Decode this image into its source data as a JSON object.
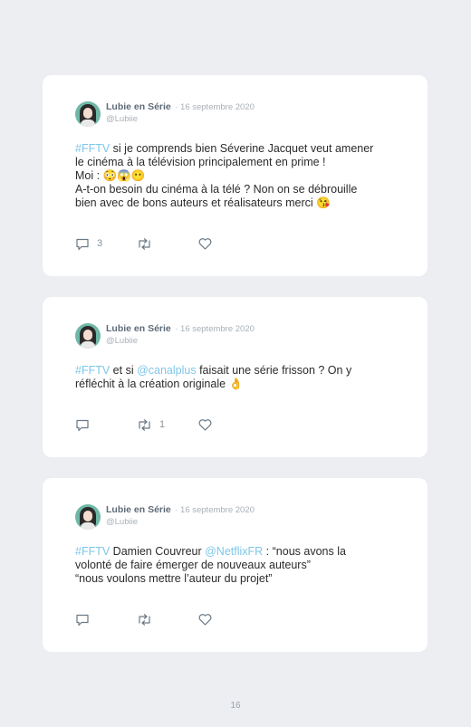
{
  "tweets": [
    {
      "author": "Lubie en Série",
      "date": "· 16 septembre 2020",
      "handle": "@Lubiie",
      "lines": [
        {
          "tag": "#FFTV",
          "text": " si je comprends bien Séverine Jacquet veut amener"
        },
        {
          "tag": "",
          "text": "le cinéma à la télévision principalement en prime !"
        },
        {
          "tag": "",
          "text": "Moi : 😳😱😶"
        },
        {
          "tag": "",
          "text": "A-t-on besoin du cinéma à la télé ? Non on se débrouille"
        },
        {
          "tag": "",
          "text": "bien avec de bons auteurs et réalisateurs merci 😘"
        }
      ],
      "replies": "3",
      "retweets": "",
      "likes": ""
    },
    {
      "author": "Lubie en Série",
      "date": "· 16 septembre 2020",
      "handle": "@Lubiie",
      "lines": [
        {
          "tag": "#FFTV",
          "text": " et si ",
          "mention": "@canalplus",
          "rest": " faisait une série frisson ? On y"
        },
        {
          "tag": "",
          "text": "réfléchit à la création originale 👌"
        }
      ],
      "replies": "",
      "retweets": "1",
      "likes": ""
    },
    {
      "author": "Lubie en Série",
      "date": "· 16 septembre 2020",
      "handle": "@Lubiie",
      "lines": [
        {
          "tag": "#FFTV",
          "text": " Damien Couvreur ",
          "mention": "@NetflixFR",
          "rest": " : “nous avons la"
        },
        {
          "tag": "",
          "text": "volonté de faire émerger de nouveaux auteurs”"
        },
        {
          "tag": "",
          "text": "“nous voulons mettre l’auteur du projet”"
        }
      ],
      "replies": "",
      "retweets": "",
      "likes": ""
    }
  ],
  "page_number": "16",
  "colors": {
    "accent": "#7ec6e8",
    "background": "#eceef1",
    "card": "#ffffff"
  }
}
